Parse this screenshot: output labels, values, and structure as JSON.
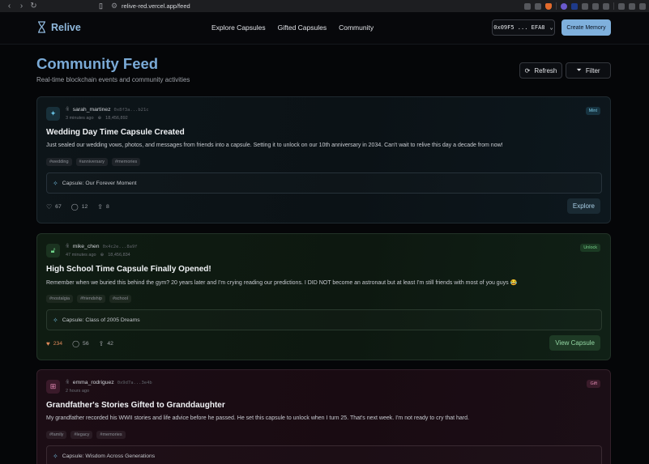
{
  "browser": {
    "url": "relive-red.vercel.app/feed"
  },
  "header": {
    "brand": "Relive",
    "nav": [
      "Explore Capsules",
      "Gifted Capsules",
      "Community"
    ],
    "wallet": "0x09F5 ... EFA8",
    "create_button": "Create Memory"
  },
  "page": {
    "title": "Community Feed",
    "subtitle": "Real-time blockchain events and community activities",
    "refresh_label": "Refresh",
    "filter_label": "Filter"
  },
  "posts": [
    {
      "username": "sarah_martinez",
      "address": "0x8f3a...b21c",
      "time": "3 minutes ago",
      "block": "18,456,892",
      "badge": "Mint",
      "title": "Wedding Day Time Capsule Created",
      "body": "Just sealed our wedding vows, photos, and messages from friends into a capsule. Setting it to unlock on our 10th anniversary in 2034. Can't wait to relive this day a decade from now!",
      "tags": [
        "#wedding",
        "#anniversary",
        "#memories"
      ],
      "capsule": "Capsule: Our Forever Moment",
      "likes": "67",
      "comments": "12",
      "shares": "8",
      "action": "Explore"
    },
    {
      "username": "mike_chen",
      "address": "0x4c2e...8a9f",
      "time": "47 minutes ago",
      "block": "18,456,834",
      "badge": "Unlock",
      "title": "High School Time Capsule Finally Opened!",
      "body": "Remember when we buried this behind the gym? 20 years later and I'm crying reading our predictions. I DID NOT become an astronaut but at least I'm still friends with most of you guys 😂",
      "tags": [
        "#nostalgia",
        "#friendship",
        "#school"
      ],
      "capsule": "Capsule: Class of 2005 Dreams",
      "likes": "234",
      "comments": "56",
      "shares": "42",
      "action": "View Capsule"
    },
    {
      "username": "emma_rodriguez",
      "address": "0x9d7a...3e4b",
      "time": "2 hours ago",
      "badge": "Gift",
      "title": "Grandfather's Stories Gifted to Granddaughter",
      "body": "My grandfather recorded his WWII stories and life advice before he passed. He set this capsule to unlock when I turn 25. That's next week. I'm not ready to cry that hard.",
      "tags": [
        "#family",
        "#legacy",
        "#memories"
      ],
      "capsule": "Capsule: Wisdom Across Generations"
    }
  ]
}
